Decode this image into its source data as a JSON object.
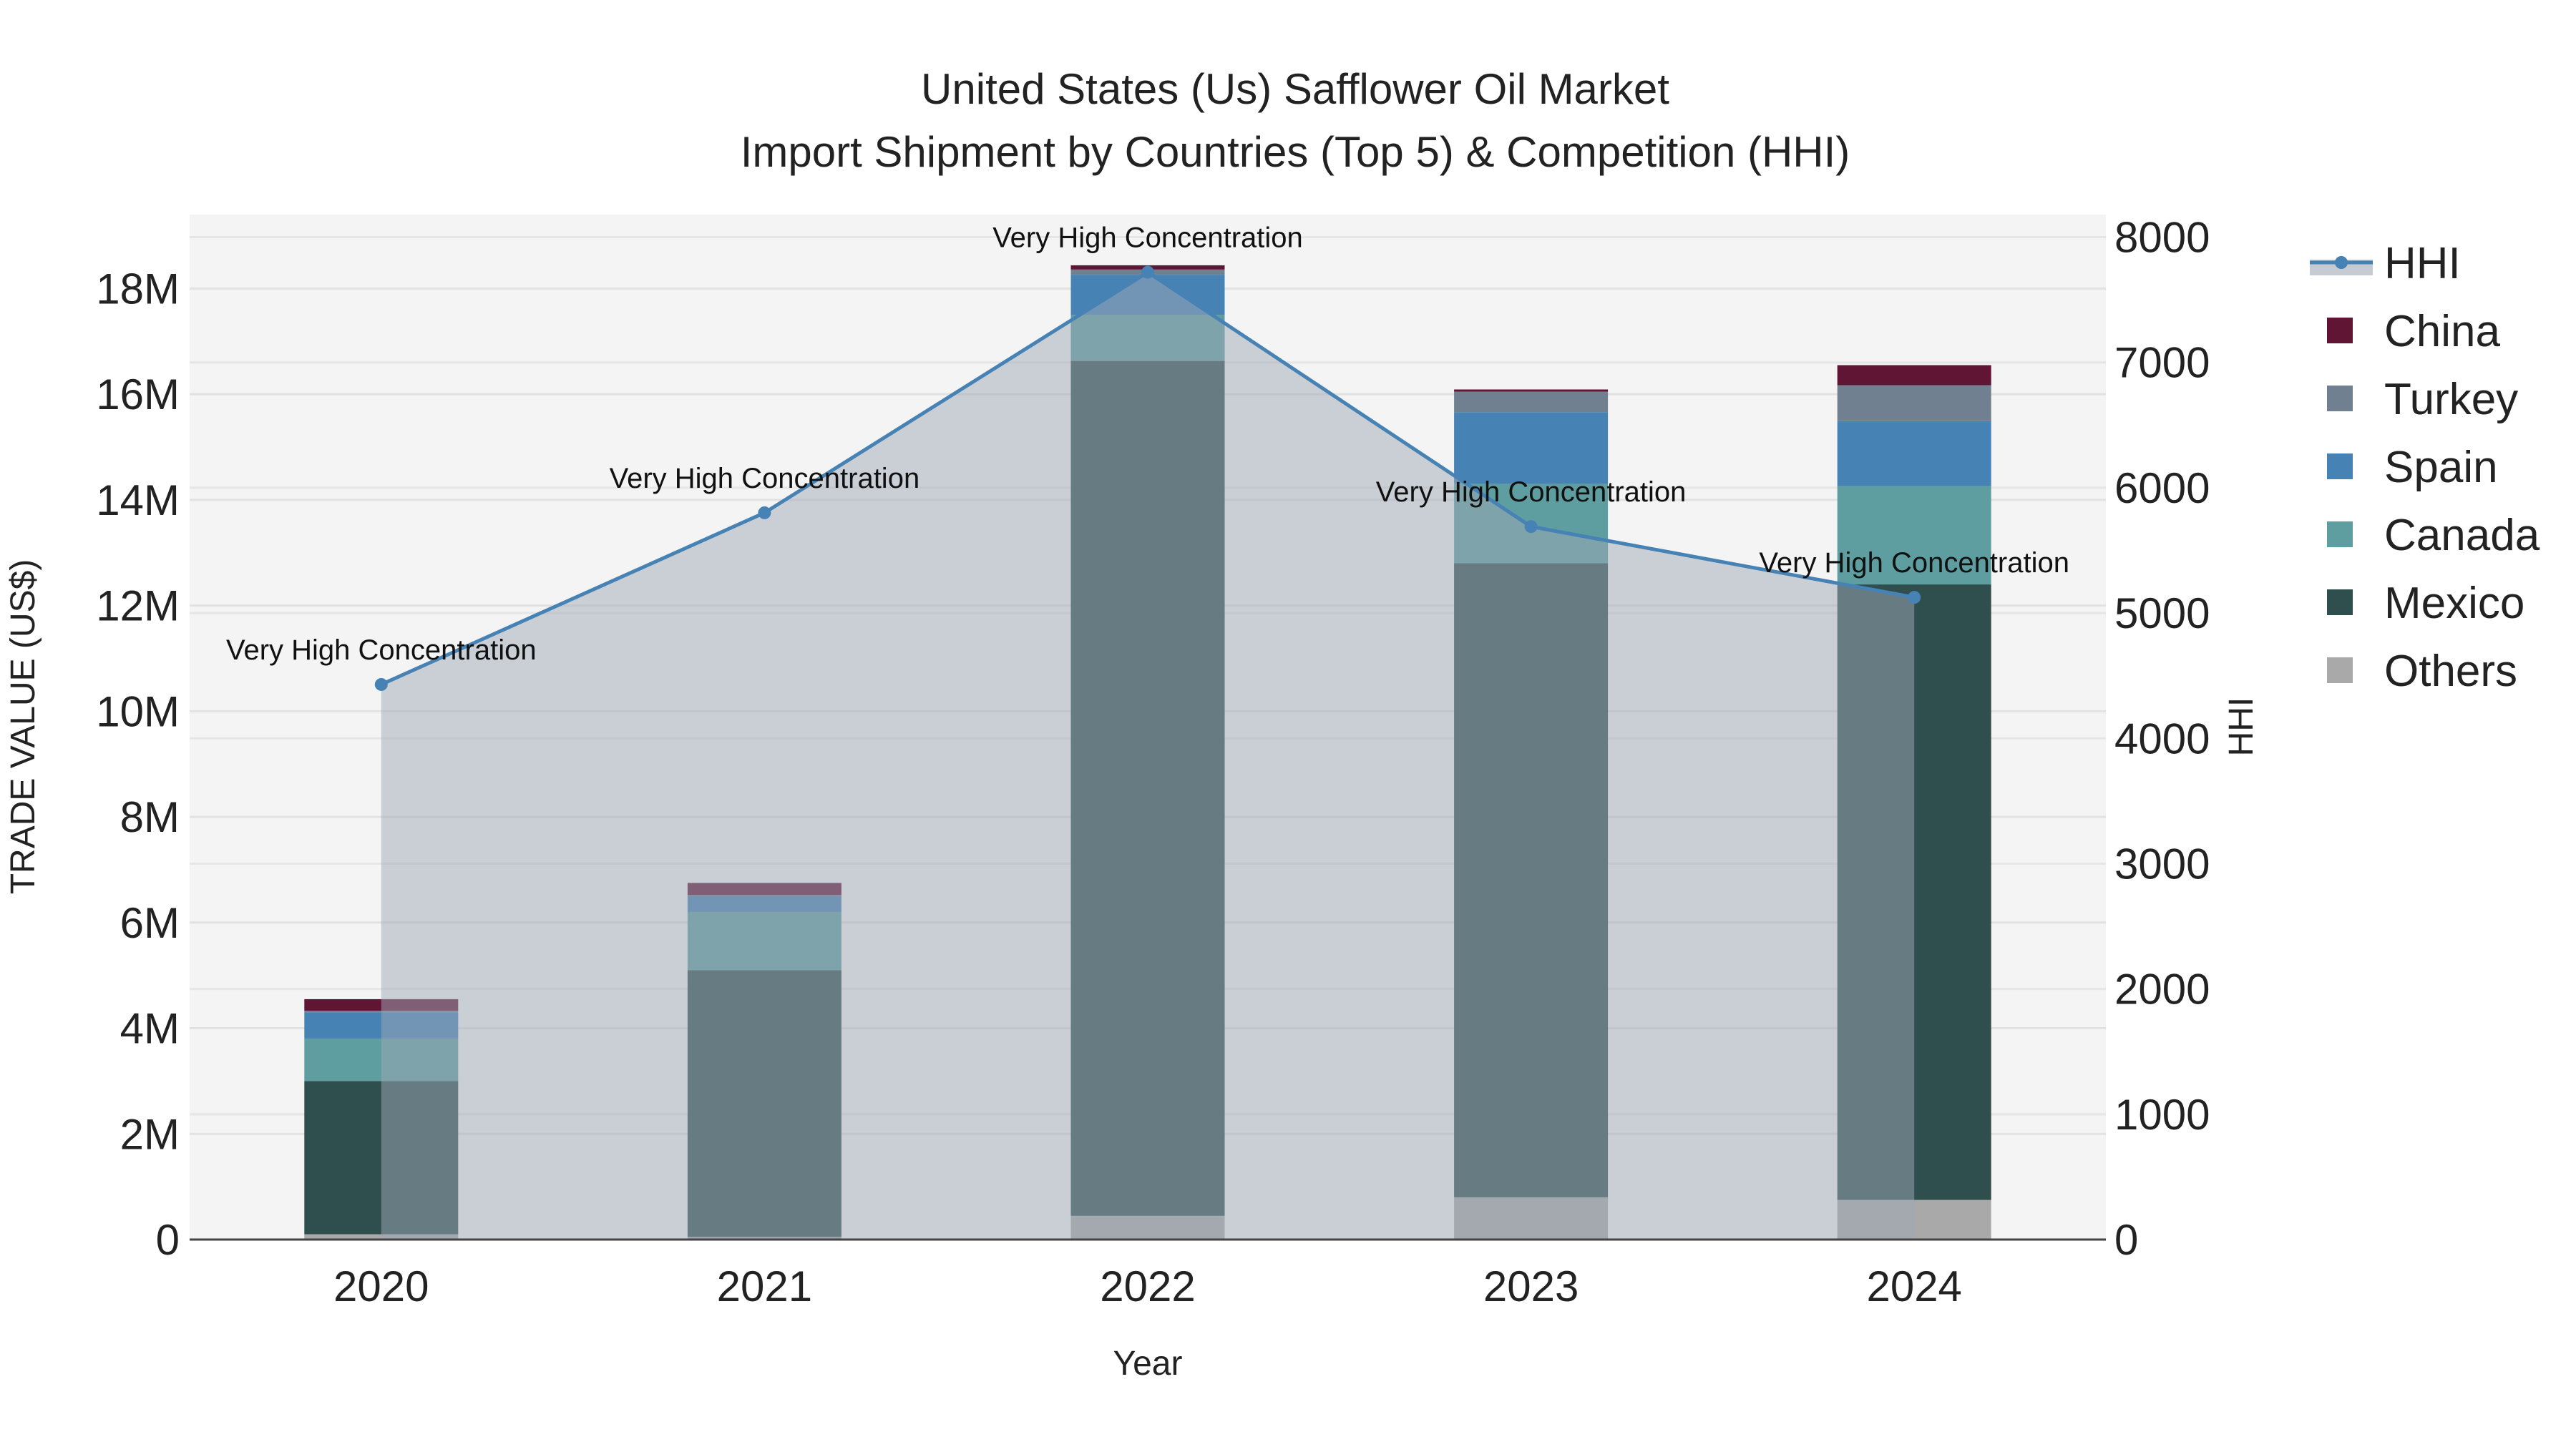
{
  "chart_data": {
    "type": "bar",
    "title_line1": "United States (Us) Safflower Oil Market",
    "title_line2": "Import Shipment by Countries (Top 5) & Competition (HHI)",
    "xlabel": "Year",
    "ylabel": "TRADE VALUE (US$)",
    "y2label": "HHI",
    "categories": [
      "2020",
      "2021",
      "2022",
      "2023",
      "2024"
    ],
    "ylim": [
      0,
      19400000
    ],
    "y2lim": [
      0,
      8180
    ],
    "yticks": [
      0,
      2000000,
      4000000,
      6000000,
      8000000,
      10000000,
      12000000,
      14000000,
      16000000,
      18000000
    ],
    "ytick_labels": [
      "0",
      "2M",
      "4M",
      "6M",
      "8M",
      "10M",
      "12M",
      "14M",
      "16M",
      "18M"
    ],
    "y2ticks": [
      0,
      1000,
      2000,
      3000,
      4000,
      5000,
      6000,
      7000,
      8000
    ],
    "y2tick_labels": [
      "0",
      "1000",
      "2000",
      "3000",
      "4000",
      "5000",
      "6000",
      "7000",
      "8000"
    ],
    "stacked": true,
    "series": [
      {
        "name": "Others",
        "color": "#a9a9a9",
        "values": [
          100000,
          50000,
          450000,
          800000,
          750000
        ]
      },
      {
        "name": "Mexico",
        "color": "#2f4f4f",
        "values": [
          2900000,
          5050000,
          16180000,
          12000000,
          11650000
        ]
      },
      {
        "name": "Canada",
        "color": "#5f9ea0",
        "values": [
          800000,
          1100000,
          870000,
          1500000,
          1860000
        ]
      },
      {
        "name": "Spain",
        "color": "#4682b4",
        "values": [
          500000,
          300000,
          760000,
          1360000,
          1230000
        ]
      },
      {
        "name": "Turkey",
        "color": "#708090",
        "values": [
          30000,
          20000,
          100000,
          390000,
          680000
        ]
      },
      {
        "name": "China",
        "color": "#611535",
        "values": [
          220000,
          230000,
          80000,
          40000,
          380000
        ]
      }
    ],
    "hhi": {
      "name": "HHI",
      "color": "#4682b4",
      "values": [
        4430,
        5800,
        7720,
        5690,
        5125
      ],
      "annotations": [
        "Very High Concentration",
        "Very High Concentration",
        "Very High Concentration",
        "Very High Concentration",
        "Very High Concentration"
      ]
    },
    "legend": [
      "HHI",
      "China",
      "Turkey",
      "Spain",
      "Canada",
      "Mexico",
      "Others"
    ],
    "legend_placement": "right",
    "grid": true
  }
}
